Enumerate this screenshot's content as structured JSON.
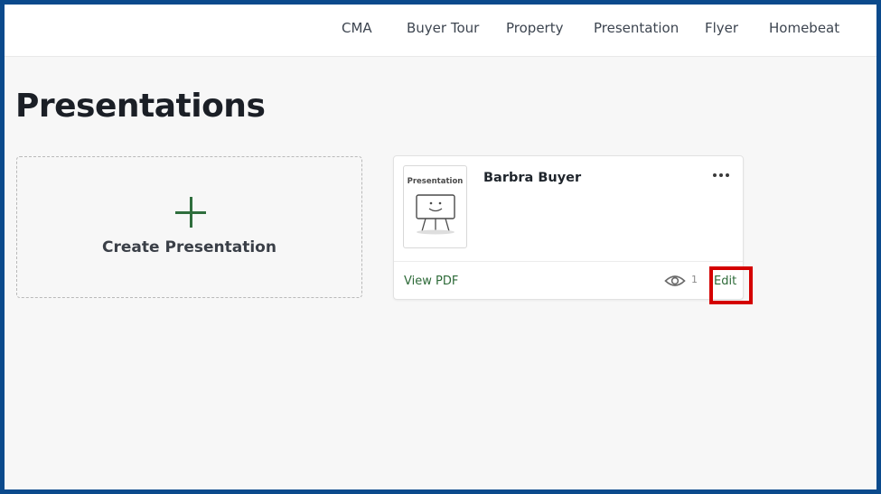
{
  "nav": {
    "items": [
      {
        "label": "CMA"
      },
      {
        "label": "Buyer Tour"
      },
      {
        "label": "Property"
      },
      {
        "label": "Presentation"
      },
      {
        "label": "Flyer"
      },
      {
        "label": "Homebeat"
      }
    ]
  },
  "page": {
    "title": "Presentations"
  },
  "create_card": {
    "icon": "plus-icon",
    "label": "Create Presentation"
  },
  "presentation_card": {
    "thumbnail_label": "Presentation",
    "thumbnail_icon": "presentation-board-icon",
    "name": "Barbra Buyer",
    "menu_icon": "more-options-icon",
    "view_pdf_label": "View PDF",
    "view_icon": "eye-icon",
    "view_count": "1",
    "edit_label": "Edit"
  },
  "colors": {
    "frame_border": "#0b4a8c",
    "accent_green": "#2d6a38",
    "highlight_red": "#d40000",
    "page_background": "#f7f7f7"
  }
}
